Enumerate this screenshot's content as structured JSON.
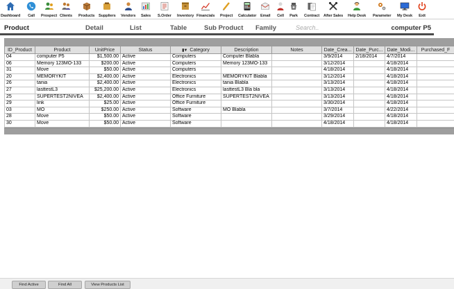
{
  "toolbar": [
    {
      "label": "Dashboard",
      "icon": "home-icon"
    },
    {
      "label": "Call",
      "icon": "phone-icon"
    },
    {
      "label": "Prospect",
      "icon": "prospect-icon"
    },
    {
      "label": "Clients",
      "icon": "clients-icon"
    },
    {
      "label": "Products",
      "icon": "box-icon"
    },
    {
      "label": "Suppliers",
      "icon": "suppliers-icon"
    },
    {
      "label": "Vendors",
      "icon": "vendors-icon"
    },
    {
      "label": "Sales",
      "icon": "sales-icon"
    },
    {
      "label": "S.Order",
      "icon": "sales-order-icon"
    },
    {
      "label": "Inventory",
      "icon": "inventory-icon"
    },
    {
      "label": "Financials",
      "icon": "financials-icon"
    },
    {
      "label": "Project",
      "icon": "project-icon"
    },
    {
      "label": "Calculator",
      "icon": "calculator-icon"
    },
    {
      "label": "Email",
      "icon": "email-icon"
    },
    {
      "label": "Cell",
      "icon": "cell-icon"
    },
    {
      "label": "Park",
      "icon": "park-icon"
    },
    {
      "label": "Contract",
      "icon": "contract-icon"
    },
    {
      "label": "After Sales",
      "icon": "tools-icon"
    },
    {
      "label": "Help Desk",
      "icon": "help-desk-icon"
    },
    {
      "label": "Parameter",
      "icon": "parameter-icon"
    },
    {
      "label": "My Desk",
      "icon": "monitor-icon"
    },
    {
      "label": "Exit",
      "icon": "power-icon"
    }
  ],
  "tabs": {
    "product": "Product",
    "detail": "Detail",
    "list": "List",
    "table": "Table",
    "sub_product": "Sub Product",
    "family": "Family",
    "search_placeholder": "Search..",
    "current_item": "computer P5"
  },
  "table": {
    "columns": [
      "ID_Product",
      "Product",
      "UnitPrice",
      "Status",
      "Category",
      "Description",
      "Notes",
      "Date_Crea...",
      "Date_Purc...",
      "Date_Modi...",
      "Purchased_F"
    ],
    "rows": [
      [
        "04",
        "computer P5",
        "$1,500.00",
        "Active",
        "Computers",
        "Computer Blabla",
        "",
        "3/9/2014",
        "2/18/2014",
        "4/7/2014",
        ""
      ],
      [
        "06",
        "Memory 123MO-133",
        "$200.00",
        "Active",
        "Computers",
        "Memory 123MO-133",
        "",
        "3/12/2014",
        "",
        "4/18/2014",
        ""
      ],
      [
        "31",
        "Move",
        "$50.00",
        "Active",
        "Computers",
        "",
        "",
        "4/18/2014",
        "",
        "4/18/2014",
        ""
      ],
      [
        "20",
        "MEMORYKIT",
        "$2,400.00",
        "Active",
        "Electronics",
        "MEMORYKIT  Blabla",
        "",
        "3/12/2014",
        "",
        "4/18/2014",
        ""
      ],
      [
        "26",
        "tania",
        "$2,400.00",
        "Active",
        "Electronics",
        "tania Blabla",
        "",
        "3/13/2014",
        "",
        "4/18/2014",
        ""
      ],
      [
        "27",
        "lasttestL3",
        "$25,200.00",
        "Active",
        "Electronics",
        "lasttestL3  Bla bla",
        "",
        "3/13/2014",
        "",
        "4/18/2014",
        ""
      ],
      [
        "25",
        "SUPERTEST2NIVEA",
        "$2,400.00",
        "Active",
        "Office Furniture",
        "SUPERTEST2NIVEA",
        "",
        "3/13/2014",
        "",
        "4/18/2014",
        ""
      ],
      [
        "29",
        "link",
        "$25.00",
        "Active",
        "Office Furniture",
        "",
        "",
        "3/30/2014",
        "",
        "4/18/2014",
        ""
      ],
      [
        "03",
        "MO",
        "$250.00",
        "Active",
        "Software",
        "MO Blabla",
        "",
        "3/7/2014",
        "",
        "4/22/2014",
        ""
      ],
      [
        "28",
        "Move",
        "$50.00",
        "Active",
        "Software",
        "",
        "",
        "3/29/2014",
        "",
        "4/18/2014",
        ""
      ],
      [
        "30",
        "Move",
        "$50.00",
        "Active",
        "Software",
        "",
        "",
        "4/18/2014",
        "",
        "4/18/2014",
        ""
      ]
    ]
  },
  "footer": {
    "find_active": "Find Active",
    "find_all": "Find All",
    "view_products_list": "View Products List"
  }
}
